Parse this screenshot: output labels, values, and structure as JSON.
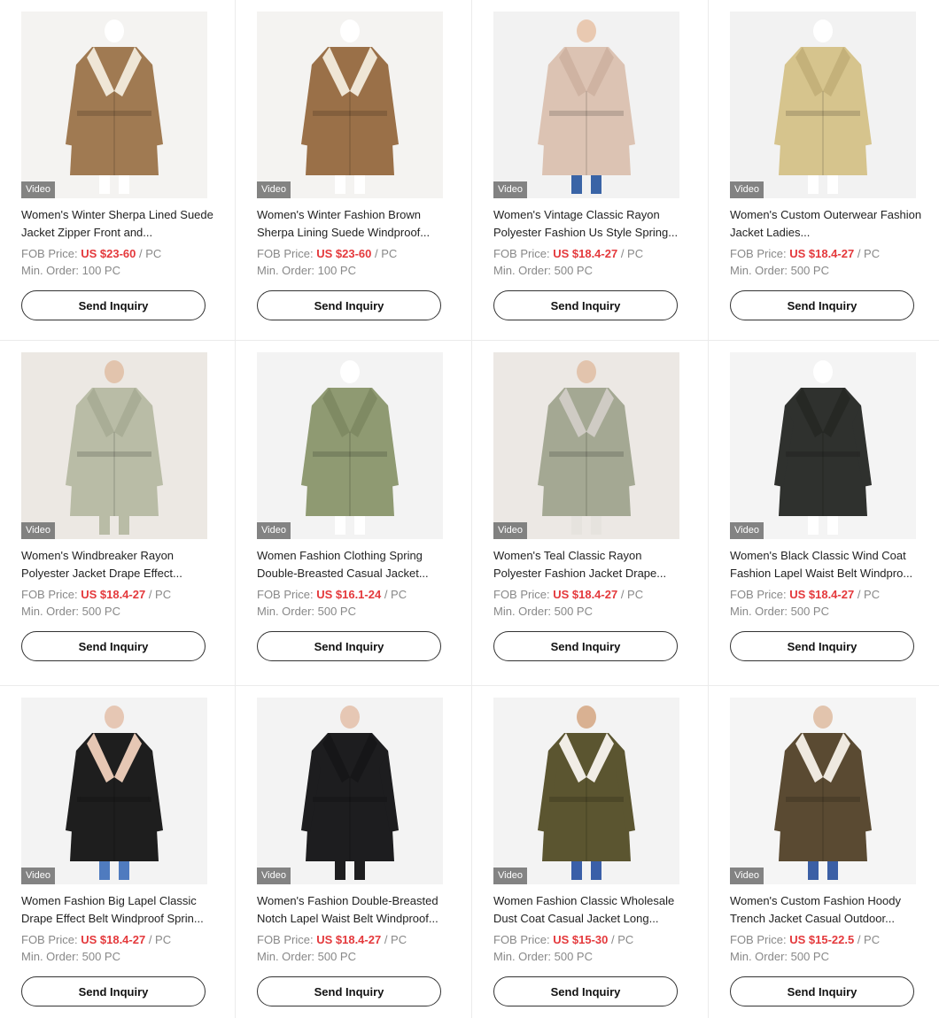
{
  "colors": {
    "price": "#e4393c",
    "muted": "#888888",
    "text": "#222222",
    "border": "#333333"
  },
  "products": [
    {
      "title": "Women's Winter Sherpa Lined Suede Jacket Zipper Front and...",
      "price_label": "FOB Price:",
      "price": "US $23-60",
      "unit": "/ PC",
      "min_order": "Min. Order: 100 PC",
      "video": "Video",
      "button": "Send Inquiry",
      "bg": "#f4f3f1",
      "coat": "#a07a52",
      "collar": "#efe6d6",
      "skin": "#ffffff",
      "legs": "#ffffff"
    },
    {
      "title": "Women's Winter Fashion Brown Sherpa Lining Suede Windproof...",
      "price_label": "FOB Price:",
      "price": "US $23-60",
      "unit": "/ PC",
      "min_order": "Min. Order: 100 PC",
      "video": "Video",
      "button": "Send Inquiry",
      "bg": "#f4f3f1",
      "coat": "#9a7048",
      "collar": "#efe6d6",
      "skin": "#ffffff",
      "legs": "#ffffff"
    },
    {
      "title": "Women's Vintage Classic Rayon Polyester Fashion Us Style Spring...",
      "price_label": "FOB Price:",
      "price": "US $18.4-27",
      "unit": "/ PC",
      "min_order": "Min. Order: 500 PC",
      "video": "Video",
      "button": "Send Inquiry",
      "bg": "#f2f2f2",
      "coat": "#dcc3b3",
      "collar": "#cfb3a2",
      "skin": "#e9c9b1",
      "legs": "#3a64a6"
    },
    {
      "title": "Women's Custom Outerwear Fashion Jacket Ladies...",
      "price_label": "FOB Price:",
      "price": "US $18.4-27",
      "unit": "/ PC",
      "min_order": "Min. Order: 500 PC",
      "video": "Video",
      "button": "Send Inquiry",
      "bg": "#f2f2f2",
      "coat": "#d6c48d",
      "collar": "#c4b17a",
      "skin": "#ffffff",
      "legs": "#ffffff"
    },
    {
      "title": "Women's Windbreaker Rayon Polyester Jacket Drape Effect...",
      "price_label": "FOB Price:",
      "price": "US $18.4-27",
      "unit": "/ PC",
      "min_order": "Min. Order: 500 PC",
      "video": "Video",
      "button": "Send Inquiry",
      "bg": "#ece8e3",
      "coat": "#b9bca6",
      "collar": "#a9ad96",
      "skin": "#e2c4ad",
      "legs": "#b9bca6"
    },
    {
      "title": "Women Fashion Clothing Spring Double-Breasted Casual Jacket...",
      "price_label": "FOB Price:",
      "price": "US $16.1-24",
      "unit": "/ PC",
      "min_order": "Min. Order: 500 PC",
      "video": "Video",
      "button": "Send Inquiry",
      "bg": "#f3f3f3",
      "coat": "#8f9a72",
      "collar": "#7f8a63",
      "skin": "#ffffff",
      "legs": "#ffffff"
    },
    {
      "title": "Women's Teal Classic Rayon Polyester Fashion Jacket Drape...",
      "price_label": "FOB Price:",
      "price": "US $18.4-27",
      "unit": "/ PC",
      "min_order": "Min. Order: 500 PC",
      "video": "Video",
      "button": "Send Inquiry",
      "bg": "#ece8e4",
      "coat": "#a4a893",
      "collar": "#cfcbc4",
      "skin": "#e2c4ad",
      "legs": "#e6e3de"
    },
    {
      "title": "Women's Black Classic Wind Coat Fashion Lapel Waist Belt Windpro...",
      "price_label": "FOB Price:",
      "price": "US $18.4-27",
      "unit": "/ PC",
      "min_order": "Min. Order: 500 PC",
      "video": "Video",
      "button": "Send Inquiry",
      "bg": "#f4f4f4",
      "coat": "#2f312e",
      "collar": "#262824",
      "skin": "#ffffff",
      "legs": "#ffffff"
    },
    {
      "title": "Women Fashion Big Lapel Classic Drape Effect Belt Windproof Sprin...",
      "price_label": "FOB Price:",
      "price": "US $18.4-27",
      "unit": "/ PC",
      "min_order": "Min. Order: 500 PC",
      "video": "Video",
      "button": "Send Inquiry",
      "bg": "#f3f3f3",
      "coat": "#1e1e1e",
      "collar": "#e6c7b4",
      "skin": "#e6c7b4",
      "legs": "#4f7bbf"
    },
    {
      "title": "Women's Fashion Double-Breasted Notch Lapel Waist Belt Windproof...",
      "price_label": "FOB Price:",
      "price": "US $18.4-27",
      "unit": "/ PC",
      "min_order": "Min. Order: 500 PC",
      "video": "Video",
      "button": "Send Inquiry",
      "bg": "#f3f3f3",
      "coat": "#1d1d1f",
      "collar": "#161618",
      "skin": "#e6c7b4",
      "legs": "#1d1d1f"
    },
    {
      "title": "Women Fashion Classic Wholesale Dust Coat Casual Jacket Long...",
      "price_label": "FOB Price:",
      "price": "US $15-30",
      "unit": "/ PC",
      "min_order": "Min. Order: 500 PC",
      "video": "Video",
      "button": "Send Inquiry",
      "bg": "#f3f3f3",
      "coat": "#5b5530",
      "collar": "#f1ede6",
      "skin": "#d9b192",
      "legs": "#3a5fa8"
    },
    {
      "title": "Women's Custom Fashion Hoody Trench Jacket Casual Outdoor...",
      "price_label": "FOB Price:",
      "price": "US $15-22.5",
      "unit": "/ PC",
      "min_order": "Min. Order: 500 PC",
      "video": "Video",
      "button": "Send Inquiry",
      "bg": "#f5f5f5",
      "coat": "#5a4a32",
      "collar": "#efe9e0",
      "skin": "#e2c4ad",
      "legs": "#3b5fa5"
    }
  ]
}
